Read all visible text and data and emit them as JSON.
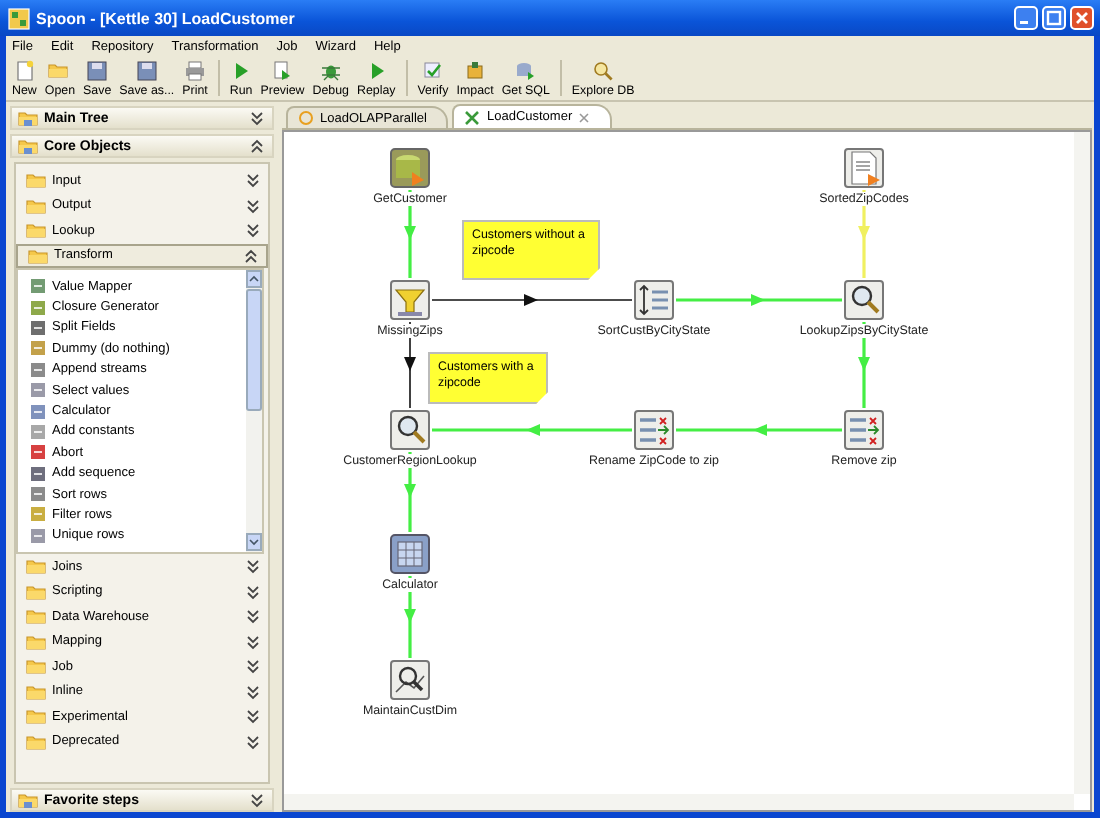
{
  "window": {
    "title": "Spoon - [Kettle 30] LoadCustomer"
  },
  "menu": [
    "File",
    "Edit",
    "Repository",
    "Transformation",
    "Job",
    "Wizard",
    "Help"
  ],
  "toolbar": [
    {
      "label": "New",
      "kind": "new"
    },
    {
      "label": "Open",
      "kind": "open"
    },
    {
      "label": "Save",
      "kind": "save"
    },
    {
      "label": "Save as...",
      "kind": "save"
    },
    {
      "label": "Print",
      "kind": "print"
    },
    {
      "label": "Run",
      "kind": "run"
    },
    {
      "label": "Preview",
      "kind": "preview"
    },
    {
      "label": "Debug",
      "kind": "debug"
    },
    {
      "label": "Replay",
      "kind": "run"
    },
    {
      "label": "Verify",
      "kind": "verify"
    },
    {
      "label": "Impact",
      "kind": "impact"
    },
    {
      "label": "Get SQL",
      "kind": "sql"
    },
    {
      "label": "Explore DB",
      "kind": "explore"
    }
  ],
  "sidebar": {
    "sections": [
      {
        "label": "Main Tree",
        "expanded": false
      },
      {
        "label": "Core Objects",
        "expanded": true,
        "categories": [
          {
            "label": "Input",
            "expanded": false
          },
          {
            "label": "Output",
            "expanded": false
          },
          {
            "label": "Lookup",
            "expanded": false
          },
          {
            "label": "Transform",
            "expanded": true,
            "items": [
              "Value Mapper",
              "Closure Generator",
              "Split Fields",
              "Dummy (do nothing)",
              "Append streams",
              "Select values",
              "Calculator",
              "Add constants",
              "Abort",
              "Add sequence",
              "Sort rows",
              "Filter rows",
              "Unique rows"
            ]
          },
          {
            "label": "Joins",
            "expanded": false
          },
          {
            "label": "Scripting",
            "expanded": false
          },
          {
            "label": "Data Warehouse",
            "expanded": false
          },
          {
            "label": "Mapping",
            "expanded": false
          },
          {
            "label": "Job",
            "expanded": false
          },
          {
            "label": "Inline",
            "expanded": false
          },
          {
            "label": "Experimental",
            "expanded": false
          },
          {
            "label": "Deprecated",
            "expanded": false
          }
        ]
      },
      {
        "label": "Favorite steps",
        "expanded": false
      }
    ]
  },
  "tabs": [
    {
      "label": "LoadOLAPParallel",
      "selected": false
    },
    {
      "label": "LoadCustomer",
      "selected": true
    }
  ],
  "canvas": {
    "steps": [
      {
        "label": "GetCustomer",
        "kind": "table-input"
      },
      {
        "label": "SortedZipCodes",
        "kind": "text-input"
      },
      {
        "label": "MissingZips",
        "kind": "filter"
      },
      {
        "label": "SortCustByCityState",
        "kind": "sort"
      },
      {
        "label": "LookupZipsByCityState",
        "kind": "lookup"
      },
      {
        "label": "CustomerRegionLookup",
        "kind": "lookup"
      },
      {
        "label": "Rename ZipCode to zip",
        "kind": "select"
      },
      {
        "label": "Remove zip",
        "kind": "select"
      },
      {
        "label": "Calculator",
        "kind": "calculator"
      },
      {
        "label": "MaintainCustDim",
        "kind": "dimension"
      }
    ],
    "notes": [
      {
        "text": "Customers without a zipcode"
      },
      {
        "text": "Customers with a zipcode"
      }
    ],
    "hops": [
      {
        "kind": "normal"
      },
      {
        "kind": "info"
      },
      {
        "kind": "conditional"
      },
      {
        "kind": "normal"
      },
      {
        "kind": "normal"
      },
      {
        "kind": "normal"
      },
      {
        "kind": "normal"
      },
      {
        "kind": "conditional"
      },
      {
        "kind": "normal"
      },
      {
        "kind": "normal"
      }
    ]
  }
}
